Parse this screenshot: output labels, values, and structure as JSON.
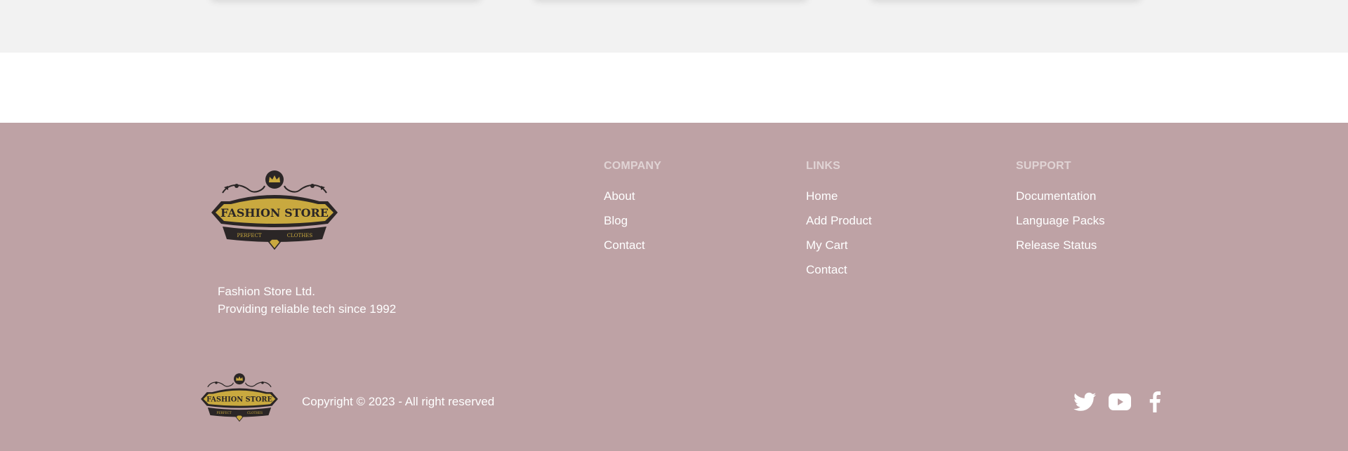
{
  "logo": {
    "name": "FASHION STORE",
    "tagline_left": "PERFECT",
    "tagline_right": "CLOTHES"
  },
  "company_info": {
    "name": "Fashion Store Ltd.",
    "description": "Providing reliable tech since 1992"
  },
  "columns": {
    "company": {
      "title": "COMPANY",
      "items": [
        "About",
        "Blog",
        "Contact"
      ]
    },
    "links": {
      "title": "LINKS",
      "items": [
        "Home",
        "Add Product",
        "My Cart",
        "Contact"
      ]
    },
    "support": {
      "title": "SUPPORT",
      "items": [
        "Documentation",
        "Language Packs",
        "Release Status"
      ]
    }
  },
  "copyright": "Copyright © 2023 - All right reserved",
  "social": [
    "twitter-icon",
    "youtube-icon",
    "facebook-icon"
  ],
  "colors": {
    "footer_bg": "#bea2a5",
    "heading": "#e0d3d4",
    "text": "#ffffff",
    "logo_gold": "#c9a93f",
    "logo_dark": "#2b2626",
    "top_band": "#f2f2f2"
  }
}
